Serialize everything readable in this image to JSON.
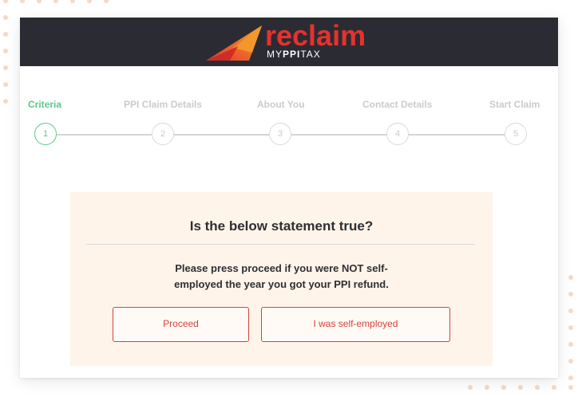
{
  "brand": {
    "name": "reclaim",
    "sub_prefix": "MY",
    "sub_bold": "PPI",
    "sub_suffix": "TAX",
    "colors": {
      "red": "#e5322d",
      "orange": "#f39a2b",
      "header_bg": "#2b2c33"
    }
  },
  "stepper": {
    "steps": [
      {
        "label": "Criteria",
        "number": "1",
        "active": true
      },
      {
        "label": "PPI Claim Details",
        "number": "2",
        "active": false
      },
      {
        "label": "About You",
        "number": "3",
        "active": false
      },
      {
        "label": "Contact Details",
        "number": "4",
        "active": false
      },
      {
        "label": "Start Claim",
        "number": "5",
        "active": false
      }
    ],
    "colors": {
      "active": "#5ac989",
      "inactive": "#c9cbce"
    }
  },
  "question": {
    "title": "Is the below statement true?",
    "text": "Please press proceed if you were NOT self-employed the year you got your PPI refund.",
    "proceed_label": "Proceed",
    "self_employed_label": "I was self-employed",
    "colors": {
      "panel_bg": "#fef4ea",
      "button_border": "#d7423a"
    }
  }
}
